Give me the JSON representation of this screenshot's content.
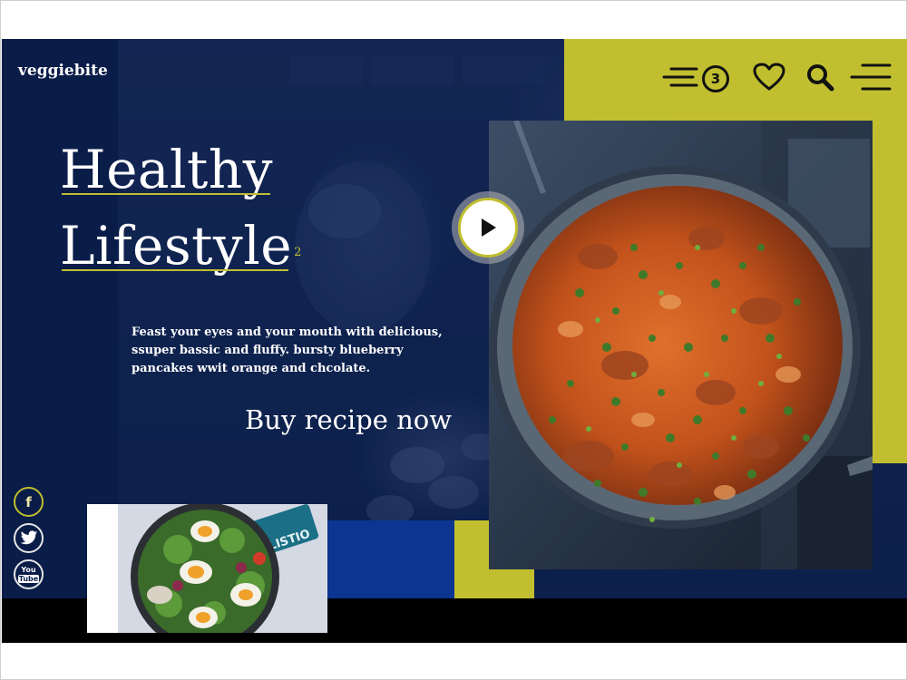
{
  "brand": {
    "name": "veggiebite"
  },
  "nav": {
    "cart_count": "3",
    "icons": [
      "menu-list-icon",
      "cart-badge",
      "heart-icon",
      "search-icon",
      "hamburger-icon"
    ]
  },
  "hero": {
    "title_line1": "Healthy",
    "title_line2": "Lifestyle",
    "title_sup": "2",
    "description": "Feast your eyes and your mouth with delicious, ssuper bassic and fluffy. bursty blueberry pancakes wwit orange and chcolate.",
    "cta": "Buy recipe now"
  },
  "social": {
    "facebook": "f",
    "youtube_top": "You",
    "youtube_bottom": "Tube"
  },
  "salad_label": "OLISTIO",
  "colors": {
    "accent": "#c1bf2f",
    "navy": "#0a1c48",
    "royal_blue": "#0b3591",
    "black": "#000000"
  }
}
